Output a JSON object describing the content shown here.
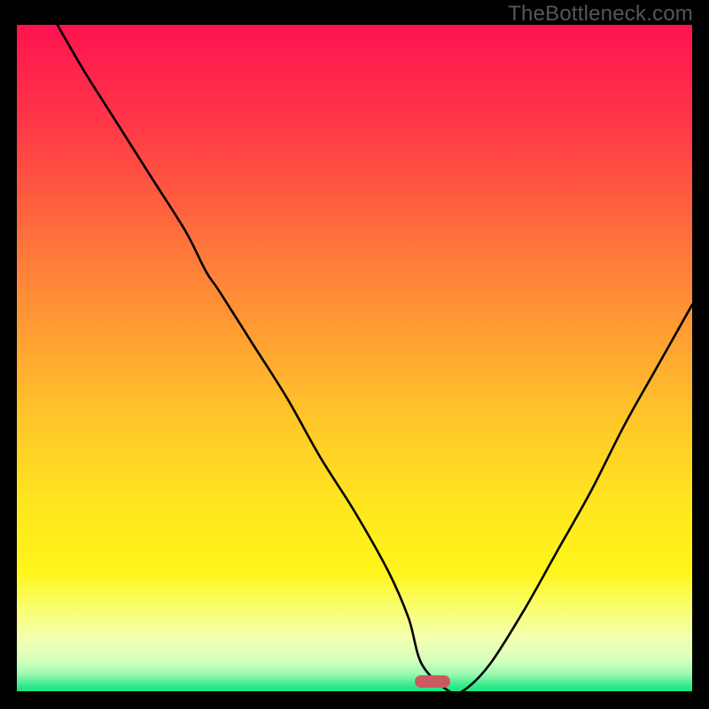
{
  "watermark": "TheBottleneck.com",
  "gradient_stops": [
    {
      "offset": 0.0,
      "color": "#ff1350"
    },
    {
      "offset": 0.15,
      "color": "#ff3747"
    },
    {
      "offset": 0.3,
      "color": "#ff6a3d"
    },
    {
      "offset": 0.45,
      "color": "#ff9a33"
    },
    {
      "offset": 0.6,
      "color": "#ffc829"
    },
    {
      "offset": 0.72,
      "color": "#ffe61f"
    },
    {
      "offset": 0.82,
      "color": "#fff51a"
    },
    {
      "offset": 0.88,
      "color": "#f8ff77"
    },
    {
      "offset": 0.92,
      "color": "#f3ffb1"
    },
    {
      "offset": 0.955,
      "color": "#d4ffbe"
    },
    {
      "offset": 0.975,
      "color": "#96f9b0"
    },
    {
      "offset": 0.99,
      "color": "#3ceb8f"
    },
    {
      "offset": 1.0,
      "color": "#15e57c"
    }
  ],
  "marker": {
    "x_pct": 61.5,
    "y_pct": 98.6,
    "color": "#cb5960"
  },
  "chart_data": {
    "type": "line",
    "title": "",
    "xlabel": "",
    "ylabel": "",
    "xlim": [
      0,
      100
    ],
    "ylim": [
      0,
      100
    ],
    "grid": false,
    "legend": false,
    "series": [
      {
        "name": "curve",
        "color": "#000000",
        "x": [
          6,
          10,
          15,
          20,
          25,
          28,
          30,
          35,
          40,
          45,
          50,
          55,
          58,
          60,
          64,
          66,
          70,
          75,
          80,
          85,
          90,
          95,
          100
        ],
        "y": [
          100,
          93,
          85,
          77,
          69,
          63,
          60,
          52,
          44,
          35,
          27,
          18,
          11,
          4,
          0,
          0,
          4,
          12,
          21,
          30,
          40,
          49,
          58
        ]
      }
    ],
    "annotations": [
      {
        "type": "marker",
        "shape": "pill",
        "x": 61.5,
        "y": 1.4,
        "color": "#cb5960"
      }
    ]
  }
}
